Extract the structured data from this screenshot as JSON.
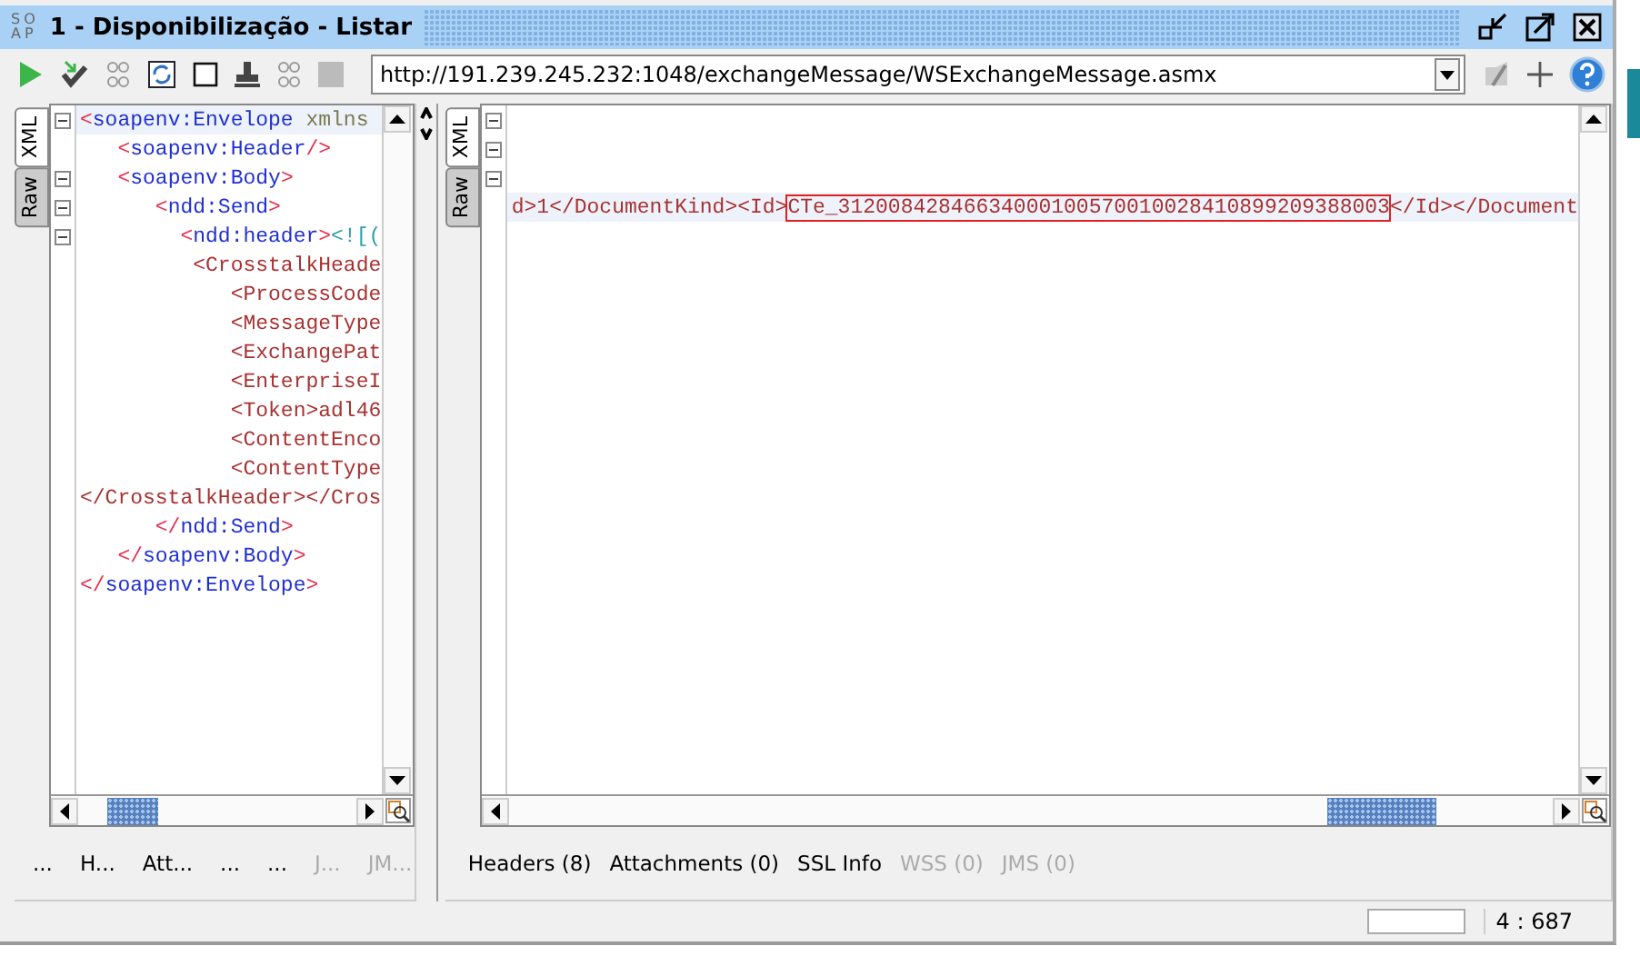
{
  "window": {
    "logo": [
      "SO",
      "AP"
    ],
    "title": "1 - Disponibilização - Listar"
  },
  "toolbar": {
    "url": "http://191.239.245.232:1048/exchangeMessage/WSExchangeMessage.asmx"
  },
  "request": {
    "side_tabs": [
      {
        "label": "XML",
        "selected": true
      },
      {
        "label": "Raw",
        "selected": false
      }
    ],
    "lines": [
      {
        "fold": true,
        "current": true,
        "tokens": [
          {
            "kind": "bracket",
            "text": "<"
          },
          {
            "kind": "ns_tag",
            "text": "soapenv:Envelope"
          },
          {
            "kind": "attr",
            "text": " xmlns"
          }
        ]
      },
      {
        "fold": false,
        "current": false,
        "tokens": [
          {
            "kind": "bracket",
            "text": "   <"
          },
          {
            "kind": "ns_tag",
            "text": "soapenv:Header"
          },
          {
            "kind": "bracket",
            "text": "/>"
          }
        ]
      },
      {
        "fold": true,
        "current": false,
        "tokens": [
          {
            "kind": "bracket",
            "text": "   <"
          },
          {
            "kind": "ns_tag",
            "text": "soapenv:Body"
          },
          {
            "kind": "bracket",
            "text": ">"
          }
        ]
      },
      {
        "fold": true,
        "current": false,
        "tokens": [
          {
            "kind": "bracket",
            "text": "      <"
          },
          {
            "kind": "ns_tag",
            "text": "ndd:Send"
          },
          {
            "kind": "bracket",
            "text": ">"
          }
        ]
      },
      {
        "fold": true,
        "current": false,
        "tokens": [
          {
            "kind": "bracket",
            "text": "        <"
          },
          {
            "kind": "ns_tag",
            "text": "ndd:header"
          },
          {
            "kind": "bracket",
            "text": ">"
          },
          {
            "kind": "cdata",
            "text": "<![("
          }
        ]
      },
      {
        "fold": false,
        "current": false,
        "tokens": [
          {
            "kind": "tag",
            "text": "         <CrosstalkHeade"
          }
        ]
      },
      {
        "fold": false,
        "current": false,
        "tokens": [
          {
            "kind": "tag",
            "text": "            <ProcessCode"
          }
        ]
      },
      {
        "fold": false,
        "current": false,
        "tokens": [
          {
            "kind": "tag",
            "text": "            <MessageType"
          }
        ]
      },
      {
        "fold": false,
        "current": false,
        "tokens": [
          {
            "kind": "tag",
            "text": "            <ExchangePat"
          }
        ]
      },
      {
        "fold": false,
        "current": false,
        "tokens": [
          {
            "kind": "tag",
            "text": "            <EnterpriseI"
          }
        ]
      },
      {
        "fold": false,
        "current": false,
        "tokens": [
          {
            "kind": "tag",
            "text": "            <Token>adl46"
          }
        ]
      },
      {
        "fold": false,
        "current": false,
        "tokens": [
          {
            "kind": "tag",
            "text": "            <ContentEnco"
          }
        ]
      },
      {
        "fold": false,
        "current": false,
        "tokens": [
          {
            "kind": "tag",
            "text": "            <ContentType"
          }
        ]
      },
      {
        "fold": false,
        "current": false,
        "tokens": [
          {
            "kind": "tag",
            "text": "</CrosstalkHeader></Cros"
          }
        ]
      },
      {
        "fold": false,
        "current": false,
        "tokens": [
          {
            "kind": "bracket",
            "text": "      </"
          },
          {
            "kind": "ns_tag",
            "text": "ndd:Send"
          },
          {
            "kind": "bracket",
            "text": ">"
          }
        ]
      },
      {
        "fold": false,
        "current": false,
        "tokens": [
          {
            "kind": "bracket",
            "text": "   </"
          },
          {
            "kind": "ns_tag",
            "text": "soapenv:Body"
          },
          {
            "kind": "bracket",
            "text": ">"
          }
        ]
      },
      {
        "fold": false,
        "current": false,
        "tokens": [
          {
            "kind": "bracket",
            "text": "</"
          },
          {
            "kind": "ns_tag",
            "text": "soapenv:Envelope"
          },
          {
            "kind": "bracket",
            "text": ">"
          }
        ]
      }
    ],
    "tabs": [
      {
        "label": "...",
        "disabled": false
      },
      {
        "label": "H...",
        "disabled": false
      },
      {
        "label": "Att...",
        "disabled": false
      },
      {
        "label": "...",
        "disabled": false
      },
      {
        "label": "...",
        "disabled": false
      },
      {
        "label": "J...",
        "disabled": true
      },
      {
        "label": "JM...",
        "disabled": true
      }
    ]
  },
  "response": {
    "side_tabs": [
      {
        "label": "XML",
        "selected": true
      },
      {
        "label": "Raw",
        "selected": false
      }
    ],
    "lines": [
      {
        "fold": true,
        "current": false
      },
      {
        "fold": true,
        "current": false
      },
      {
        "fold": true,
        "current": false
      },
      {
        "fold": false,
        "current": true,
        "tokens": [
          {
            "kind": "tag",
            "text": "d>1</DocumentKind><Id>"
          },
          {
            "kind": "match",
            "text": "CTe_31200842846634000100570010028410899209388003"
          },
          {
            "kind": "tag",
            "text": "</Id></Document"
          }
        ]
      }
    ],
    "tabs": [
      {
        "label": "Headers (8)",
        "disabled": false
      },
      {
        "label": "Attachments (0)",
        "disabled": false
      },
      {
        "label": "SSL Info",
        "disabled": false
      },
      {
        "label": "WSS (0)",
        "disabled": true
      },
      {
        "label": "JMS (0)",
        "disabled": true
      }
    ]
  },
  "status_bar": {
    "position": "4 : 687"
  }
}
